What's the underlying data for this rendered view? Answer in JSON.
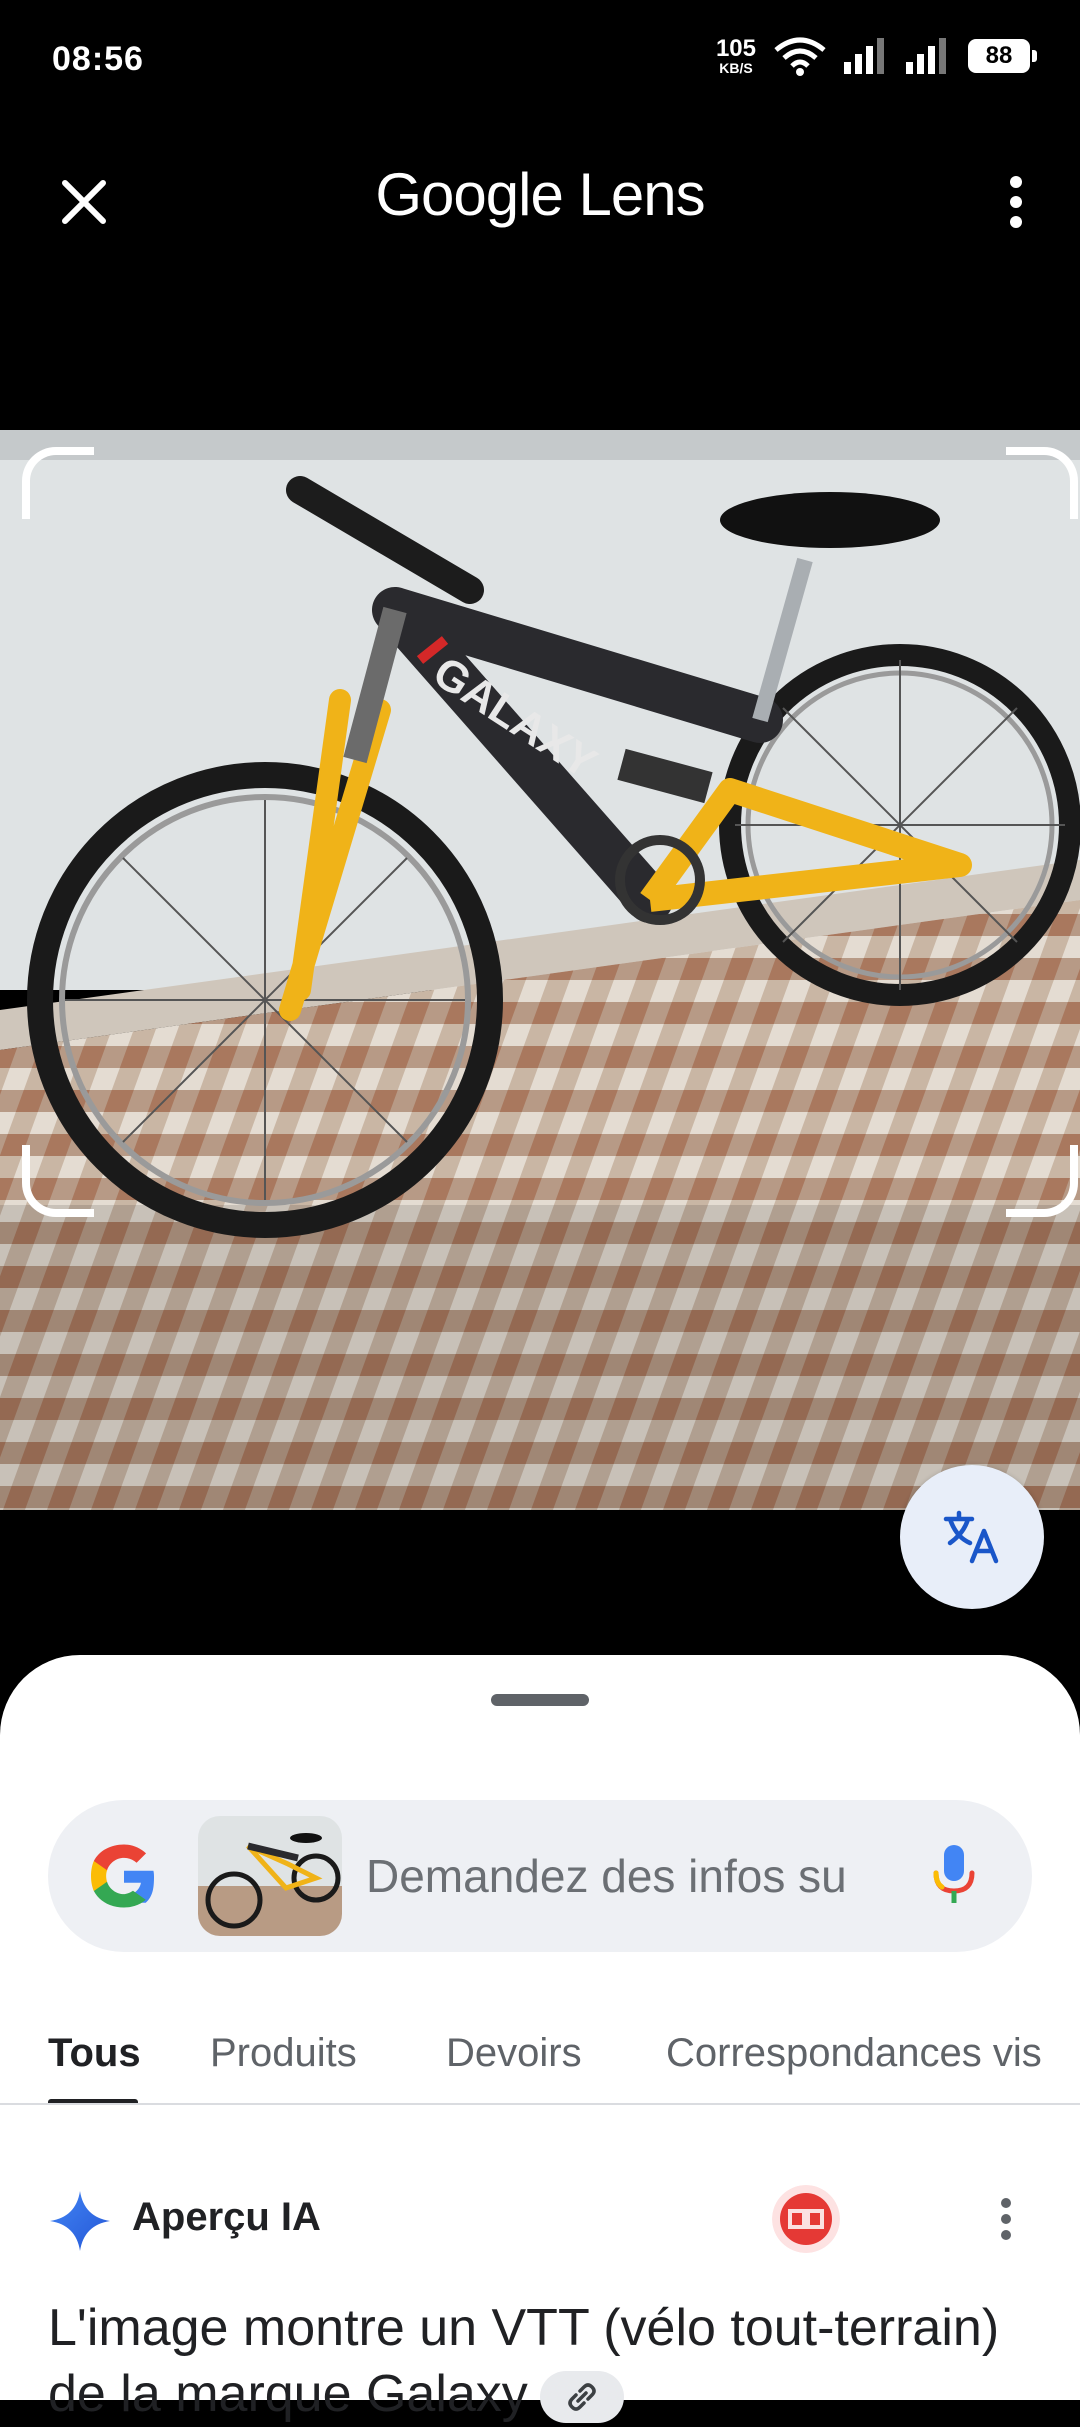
{
  "status_bar": {
    "time": "08:56",
    "net_speed_value": "105",
    "net_speed_unit": "KB/S",
    "battery": "88",
    "icons": [
      "wifi-icon",
      "signal-icon",
      "signal-icon",
      "battery-icon"
    ]
  },
  "header": {
    "title_brand": "Google",
    "title_product": "Lens",
    "close_icon": "close-icon",
    "menu_icon": "more-vert-icon"
  },
  "photo": {
    "subject": "bicycle photo",
    "translate_icon": "translate-icon"
  },
  "search": {
    "placeholder": "Demandez des infos su",
    "mic_icon": "mic-icon",
    "logo_icon": "google-g-icon"
  },
  "tabs": [
    {
      "label": "Tous",
      "active": true
    },
    {
      "label": "Produits",
      "active": false
    },
    {
      "label": "Devoirs",
      "active": false
    },
    {
      "label": "Correspondances vis",
      "active": false
    }
  ],
  "ai_overview": {
    "title": "Aperçu IA",
    "text": "L'image montre un VTT (vélo tout-terrain) de la marque Galaxy",
    "icon": "sparkle-icon",
    "link_icon": "link-icon"
  },
  "colors": {
    "google_blue": "#4285F4",
    "google_red": "#EA4335",
    "google_yellow": "#FBBC05",
    "google_green": "#34A853",
    "sheet_bg": "#ffffff",
    "search_bg": "#eef0f4"
  }
}
